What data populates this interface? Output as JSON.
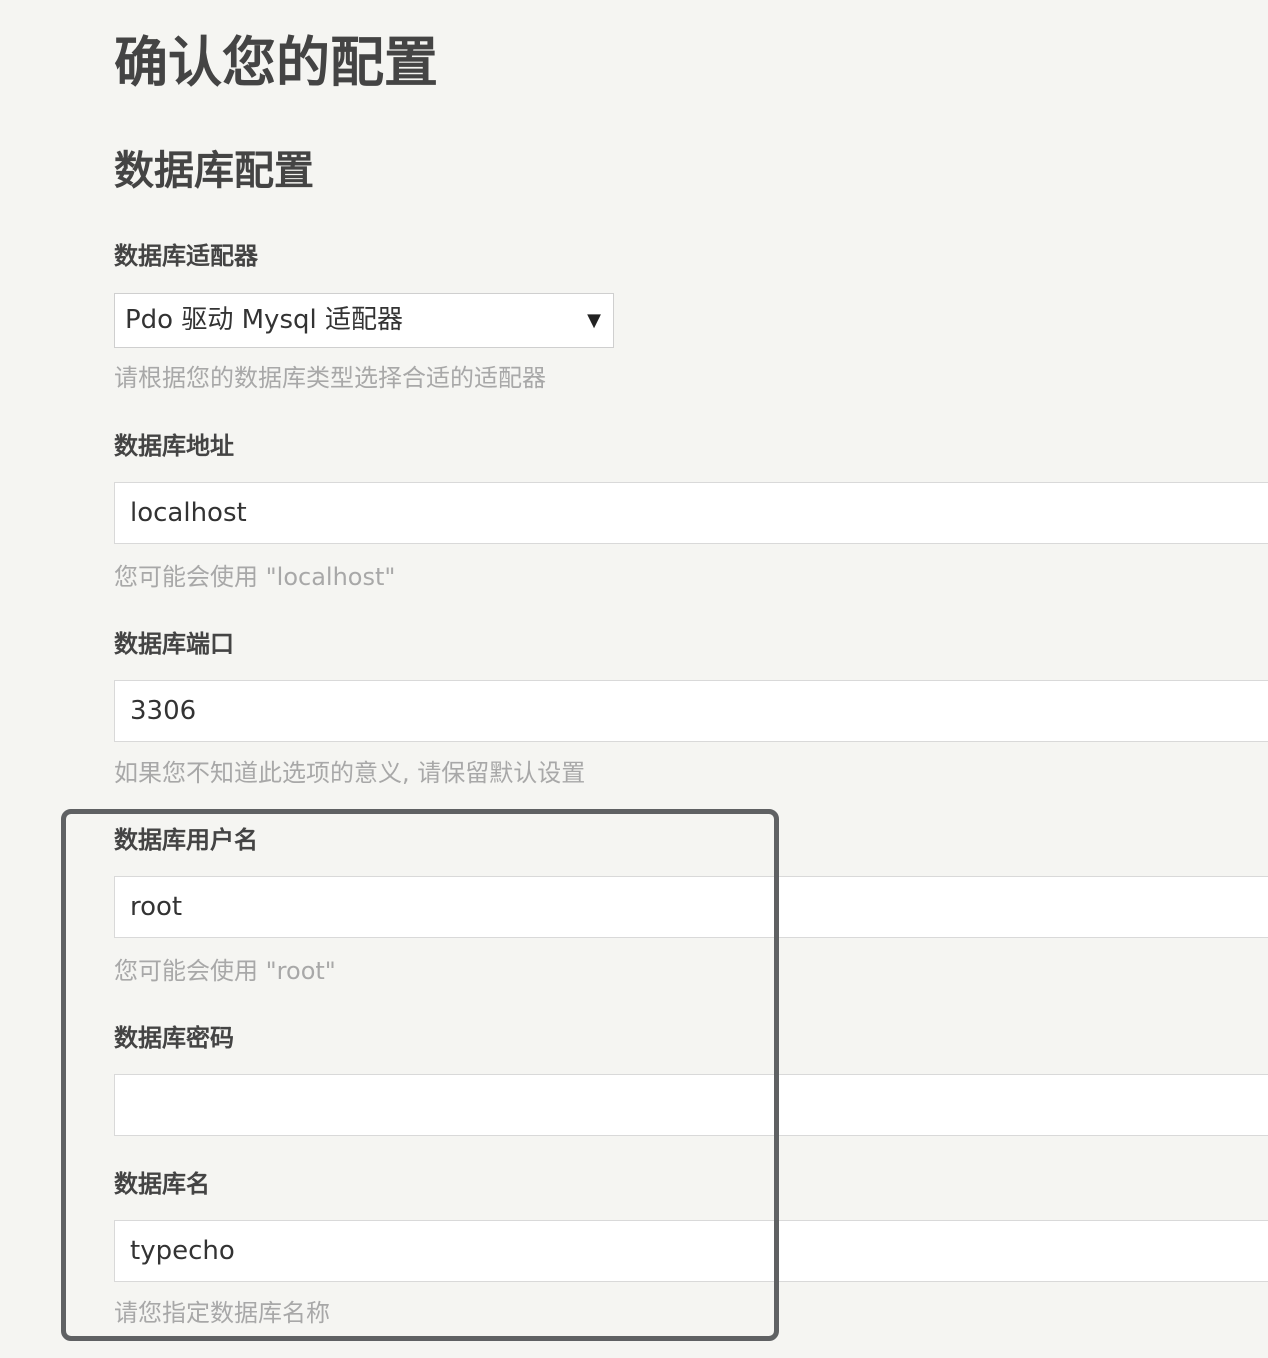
{
  "page": {
    "title": "确认您的配置"
  },
  "database": {
    "section_title": "数据库配置",
    "adapter": {
      "label": "数据库适配器",
      "selected": "Pdo 驱动 Mysql 适配器",
      "arrow_icon": "dropdown-arrow-icon",
      "hint": "请根据您的数据库类型选择合适的适配器"
    },
    "host": {
      "label": "数据库地址",
      "value": "localhost",
      "hint": "您可能会使用 \"localhost\""
    },
    "port": {
      "label": "数据库端口",
      "value": "3306",
      "hint": "如果您不知道此选项的意义, 请保留默认设置"
    },
    "user": {
      "label": "数据库用户名",
      "value": "root",
      "hint": "您可能会使用 \"root\""
    },
    "password": {
      "label": "数据库密码",
      "value": ""
    },
    "name": {
      "label": "数据库名",
      "value": "typecho",
      "hint": "请您指定数据库名称"
    }
  },
  "colors": {
    "background": "#f5f5f2",
    "text": "#444444",
    "hint": "#a8a8a8",
    "highlight_frame": "#5f6163"
  }
}
